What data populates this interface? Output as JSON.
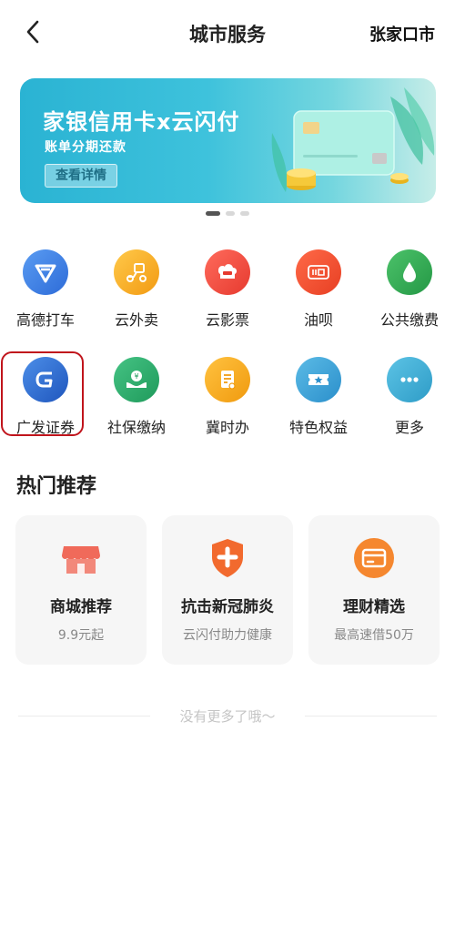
{
  "header": {
    "title": "城市服务",
    "city": "张家口市"
  },
  "banner": {
    "title": "家银信用卡x云闪付",
    "subtitle": "账单分期还款",
    "button": "查看详情",
    "dots": 3,
    "active_dot": 0
  },
  "services": [
    {
      "label": "高德打车",
      "icon": "navigation-icon",
      "color": "#3e7ee6"
    },
    {
      "label": "云外卖",
      "icon": "scooter-icon",
      "color": "#f6a51e"
    },
    {
      "label": "云影票",
      "icon": "ticket-icon",
      "color": "#ee4b41"
    },
    {
      "label": "油呗",
      "icon": "oil-icon",
      "color": "#f05236"
    },
    {
      "label": "公共缴费",
      "icon": "water-drop-icon",
      "color": "#34a853"
    },
    {
      "label": "广发证券",
      "icon": "gf-securities-icon",
      "color": "#2d6fd1"
    },
    {
      "label": "社保缴纳",
      "icon": "social-security-icon",
      "color": "#2faa6d"
    },
    {
      "label": "冀时办",
      "icon": "document-icon",
      "color": "#f3a91a"
    },
    {
      "label": "特色权益",
      "icon": "star-ticket-icon",
      "color": "#3aa7d8"
    },
    {
      "label": "更多",
      "icon": "more-icon",
      "color": "#3ab1d6"
    }
  ],
  "section": {
    "title": "热门推荐"
  },
  "cards": [
    {
      "title": "商城推荐",
      "subtitle": "9.9元起",
      "icon": "store-icon",
      "color": "#ef5a4a"
    },
    {
      "title": "抗击新冠肺炎",
      "subtitle": "云闪付助力健康",
      "icon": "shield-cross-icon",
      "color": "#f05a2a"
    },
    {
      "title": "理财精选",
      "subtitle": "最高速借50万",
      "icon": "card-icon",
      "color": "#f47c2a"
    }
  ],
  "footer": {
    "no_more": "没有更多了哦～"
  }
}
